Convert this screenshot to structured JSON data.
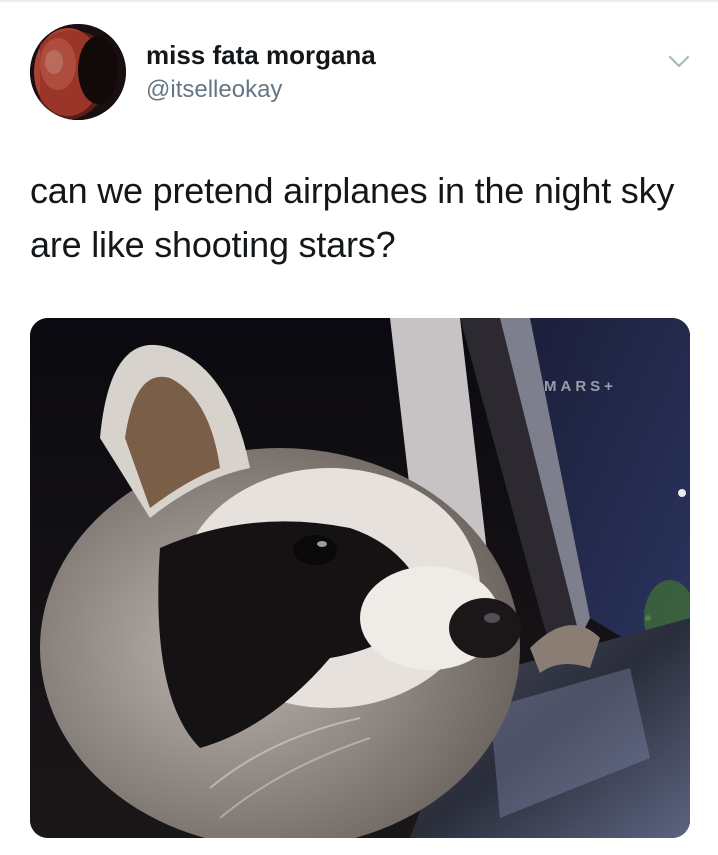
{
  "tweet": {
    "author": {
      "display_name": "miss fata morgana",
      "handle": "@itselleokay",
      "avatar_icon": "profile-avatar"
    },
    "menu_icon": "chevron-down-icon",
    "text": "can we pretend airplanes in the night sky are like shooting stars?",
    "media": {
      "description_icon": "raccoon-photo",
      "watermark": "MARS+"
    }
  },
  "colors": {
    "text_primary": "#14171a",
    "text_secondary": "#657786",
    "chevron": "#aab8c2",
    "background": "#ffffff"
  }
}
